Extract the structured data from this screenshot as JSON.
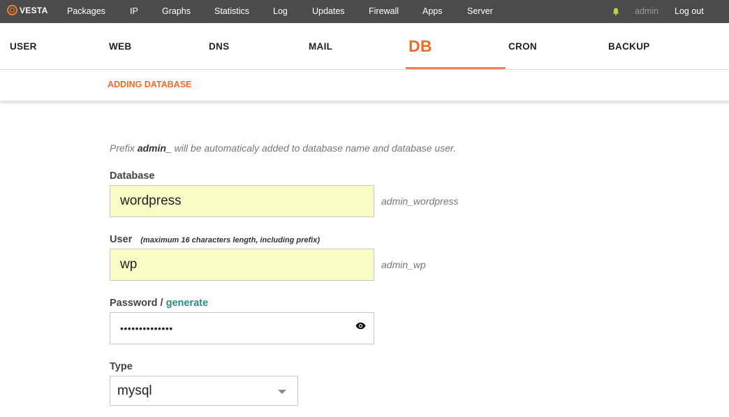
{
  "topbar": {
    "logo_text": "VESTA",
    "nav": [
      "Packages",
      "IP",
      "Graphs",
      "Statistics",
      "Log",
      "Updates",
      "Firewall",
      "Apps",
      "Server"
    ],
    "user": "admin",
    "logout": "Log out",
    "bell_icon": "bell-icon",
    "accent": "#f57f38"
  },
  "tabs": [
    "USER",
    "WEB",
    "DNS",
    "MAIL",
    "DB",
    "CRON",
    "BACKUP"
  ],
  "active_tab": "DB",
  "subtitle": "ADDING DATABASE",
  "form": {
    "prefix_pre": "Prefix ",
    "prefix_bold": "admin_",
    "prefix_post": " will be automaticaly added to database name and database user.",
    "database_label": "Database",
    "database_value": "wordpress",
    "database_full": "admin_wordpress",
    "user_label": "User",
    "user_hint": "(maximum 16 characters length, including prefix)",
    "user_value": "wp",
    "user_full": "admin_wp",
    "password_label": "Password / ",
    "generate_link": "generate",
    "password_mask": "••••••••••••••",
    "type_label": "Type",
    "type_value": "mysql"
  }
}
